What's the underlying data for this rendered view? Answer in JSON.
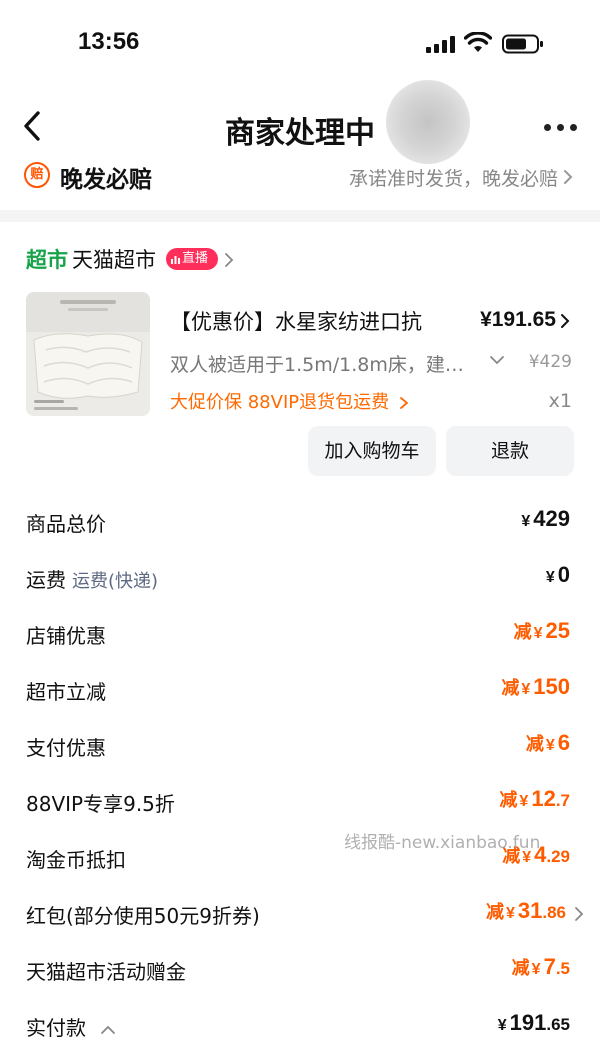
{
  "status_bar": {
    "time": "13:56"
  },
  "nav": {
    "title": "商家处理中"
  },
  "compensation": {
    "badge": "赔",
    "title": "晚发必赔",
    "desc": "承诺准时发货，晚发必赔"
  },
  "store": {
    "tag": "超市",
    "name": "天猫超市",
    "live_badge": "直播"
  },
  "product": {
    "title": "【优惠价】水星家纺进口抗",
    "price": "¥191.65",
    "spec": "双人被适用于1.5m/1.8m床，建…",
    "original_price": "¥429",
    "promo": "大促价保  88VIP退货包运费",
    "quantity": "x1"
  },
  "actions": {
    "add_to_cart": "加入购物车",
    "refund": "退款"
  },
  "breakdown": {
    "total": {
      "label": "商品总价",
      "currency": "¥",
      "value": "429"
    },
    "shipping": {
      "label": "运费",
      "sub": "运费(快递)",
      "currency": "¥",
      "value": "0"
    },
    "store_discount": {
      "label": "店铺优惠",
      "prefix": "减",
      "currency": "¥",
      "value": "25"
    },
    "market_discount": {
      "label": "超市立减",
      "prefix": "减",
      "currency": "¥",
      "value": "150"
    },
    "payment_discount": {
      "label": "支付优惠",
      "prefix": "减",
      "currency": "¥",
      "value": "6"
    },
    "vip_discount": {
      "label": "88VIP专享9.5折",
      "prefix": "减",
      "currency": "¥",
      "int": "12",
      "dec": ".7"
    },
    "taojinbi": {
      "label": "淘金币抵扣",
      "prefix": "减",
      "currency": "¥",
      "int": "4",
      "dec": ".29"
    },
    "red_packet": {
      "label": "红包(部分使用50元9折券)",
      "prefix": "减",
      "currency": "¥",
      "int": "31",
      "dec": ".86"
    },
    "gift_money": {
      "label": "天猫超市活动赠金",
      "prefix": "减",
      "currency": "¥",
      "int": "7",
      "dec": ".5"
    },
    "paid": {
      "label": "实付款",
      "currency": "¥",
      "int": "191",
      "dec": ".65"
    }
  },
  "watermark": "线报酷-new.xianbao.fun",
  "colors": {
    "accent": "#ff5c00",
    "store_green": "#16a34a",
    "live_red": "#ff2e5a"
  },
  "icons": [
    "back-arrow-icon",
    "more-icon",
    "chevron-right-icon",
    "chevron-down-icon",
    "chevron-up-icon",
    "signal-icon",
    "wifi-icon",
    "battery-icon"
  ]
}
